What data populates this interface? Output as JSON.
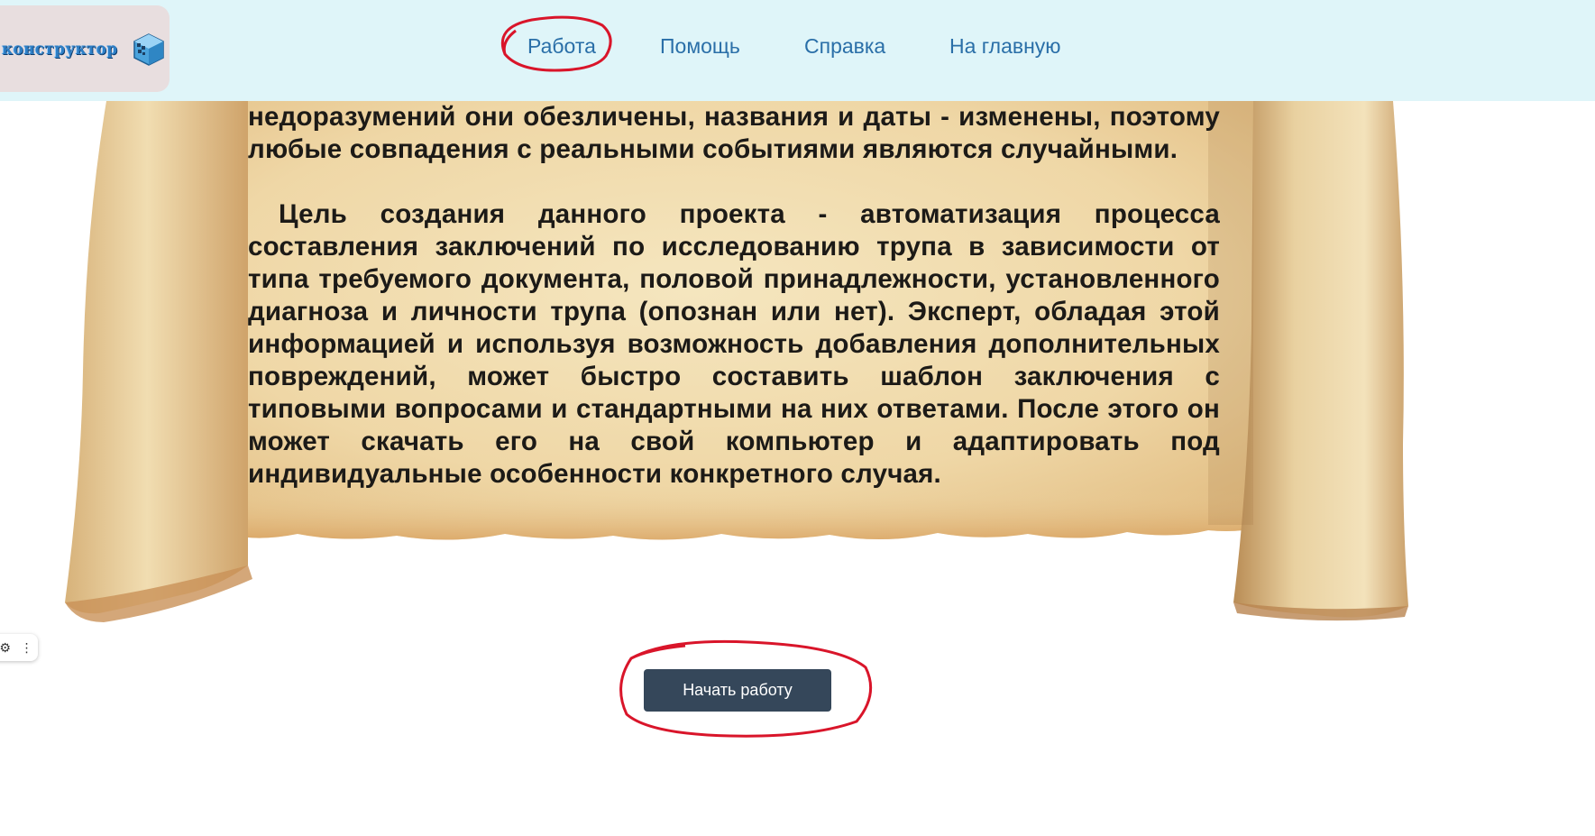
{
  "header": {
    "logo_text": "конструктор",
    "nav": [
      {
        "label": "Работа"
      },
      {
        "label": "Помощь"
      },
      {
        "label": "Справка"
      },
      {
        "label": "На главную"
      }
    ]
  },
  "content": {
    "paragraph_1": "недоразумений они обезличены, названия и даты - изменены, поэтому любые совпадения с реальными событиями являются случайными.",
    "paragraph_2": "Цель создания данного проекта - автоматизация процесса составления заключений по исследованию трупа в зависимости от типа требуемого документа, половой принадлежности, установленного диагноза и личности трупа (опознан или нет). Эксперт, обладая этой информацией и используя возможность добавления дополнительных повреждений, может быстро составить шаблон заключения с типовыми вопросами и стандартными на них ответами. После этого он может скачать его на свой компьютер и адаптировать под индивидуальные особенности конкретного случая."
  },
  "actions": {
    "start_label": "Начать работу"
  },
  "side_widget": {
    "icons": [
      "puzzle-icon",
      "more-vertical-icon"
    ]
  },
  "colors": {
    "header_bg": "#dff5f9",
    "nav_link": "#2a6fa8",
    "button_bg": "#35475a",
    "annotation_red": "#d9152a",
    "paper": "#f1dfb3"
  }
}
